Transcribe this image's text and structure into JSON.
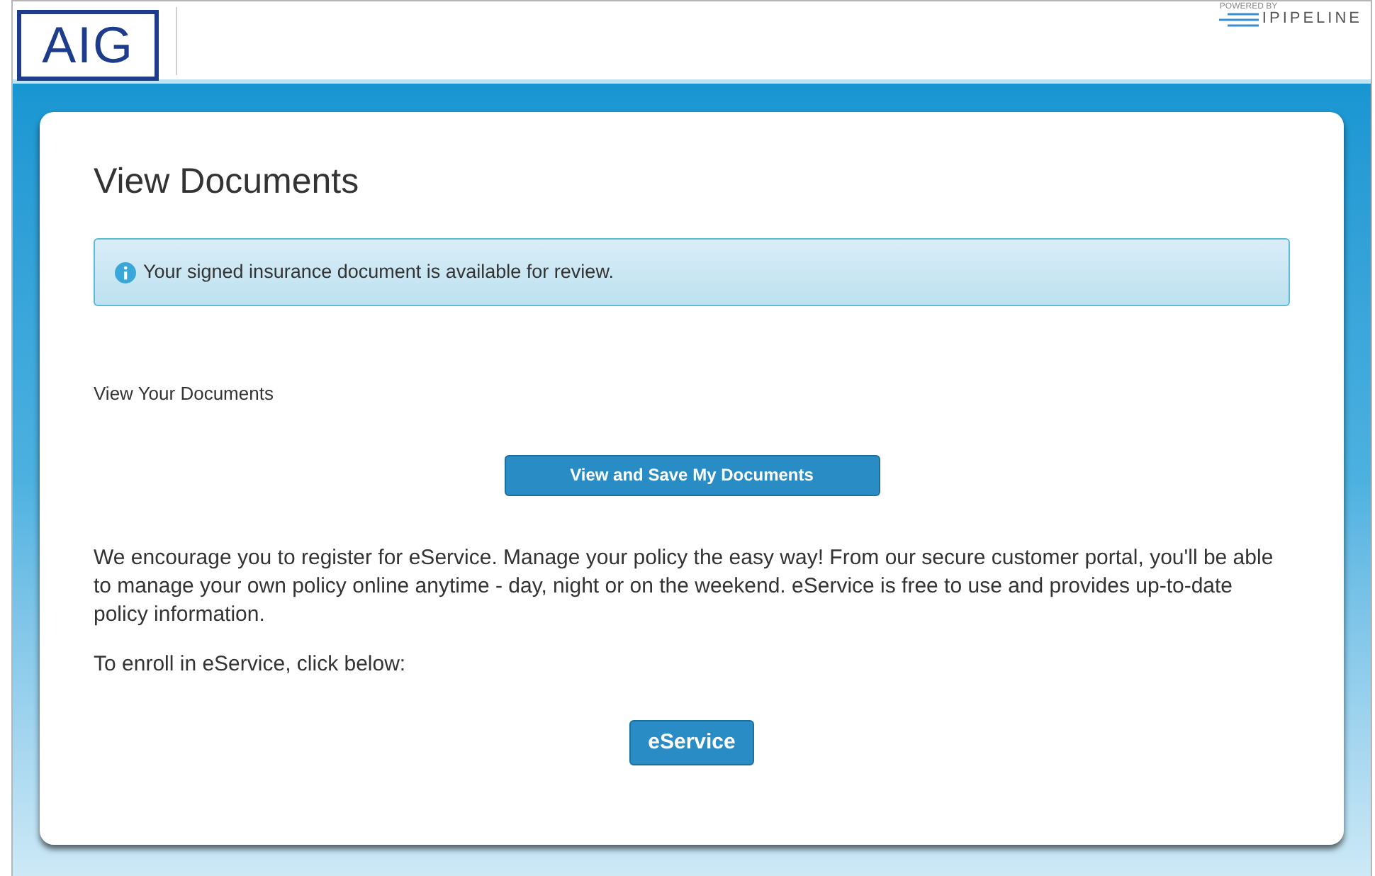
{
  "header": {
    "logo": "AIG",
    "powered_by": "POWERED BY",
    "brand": "IPIPELINE"
  },
  "page": {
    "title": "View Documents",
    "alert": "Your signed insurance document is available for review.",
    "section_label": "View Your Documents",
    "documents_button": "View and Save My Documents",
    "paragraph": "We encourage you to register for eService. Manage your policy the easy way! From our secure customer portal, you'll be able to manage your own policy online anytime - day, night or on the weekend. eService is free to use and provides up-to-date policy information.",
    "enroll_text": "To enroll in eService, click below:",
    "eservice_button": "eService"
  }
}
